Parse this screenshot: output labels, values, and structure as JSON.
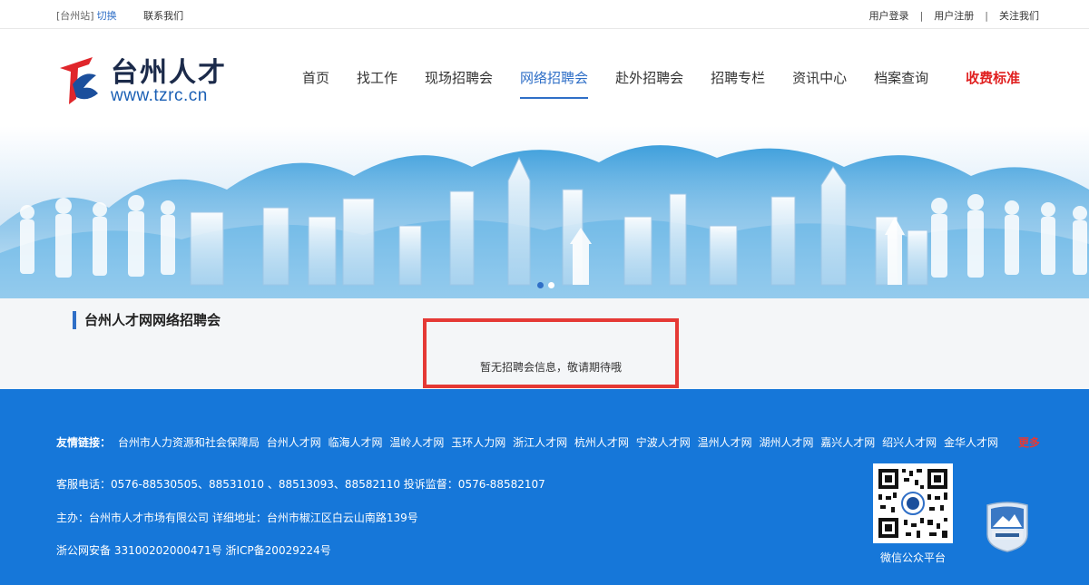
{
  "topbar": {
    "station": "[台州站]",
    "switch_label": "切换",
    "contact_label": "联系我们",
    "user_login": "用户登录",
    "user_register": "用户注册",
    "follow_us": "关注我们",
    "separator": "|"
  },
  "logo": {
    "title": "台州人才",
    "url": "www.tzrc.cn"
  },
  "nav": {
    "items": [
      {
        "label": "首页"
      },
      {
        "label": "找工作"
      },
      {
        "label": "现场招聘会"
      },
      {
        "label": "网络招聘会"
      },
      {
        "label": "赴外招聘会"
      },
      {
        "label": "招聘专栏"
      },
      {
        "label": "资讯中心"
      },
      {
        "label": "档案查询"
      },
      {
        "label": "收费标准"
      }
    ],
    "active_index": 3
  },
  "colors": {
    "accent": "#2f6fc7",
    "footer_bg": "#1677d9",
    "highlight_red": "#e53935"
  },
  "content": {
    "section_title": "台州人才网网络招聘会",
    "empty_message": "暂无招聘会信息，敬请期待哦"
  },
  "footer": {
    "links_label": "友情链接：",
    "links": [
      "台州市人力资源和社会保障局",
      "台州人才网",
      "临海人才网",
      "温岭人才网",
      "玉环人力网",
      "浙江人才网",
      "杭州人才网",
      "宁波人才网",
      "温州人才网",
      "湖州人才网",
      "嘉兴人才网",
      "绍兴人才网",
      "金华人才网"
    ],
    "more_label": "更多",
    "service_phone": "客服电话：0576-88530505、88531010 、88513093、88582110 投诉监督：0576-88582107",
    "host": "主办：台州市人才市场有限公司 详细地址：台州市椒江区白云山南路139号",
    "icp": "浙公网安备 33100202000471号 浙ICP备20029224号",
    "qr_label": "微信公众平台",
    "badge_icon": "public-institution-badge-icon"
  }
}
